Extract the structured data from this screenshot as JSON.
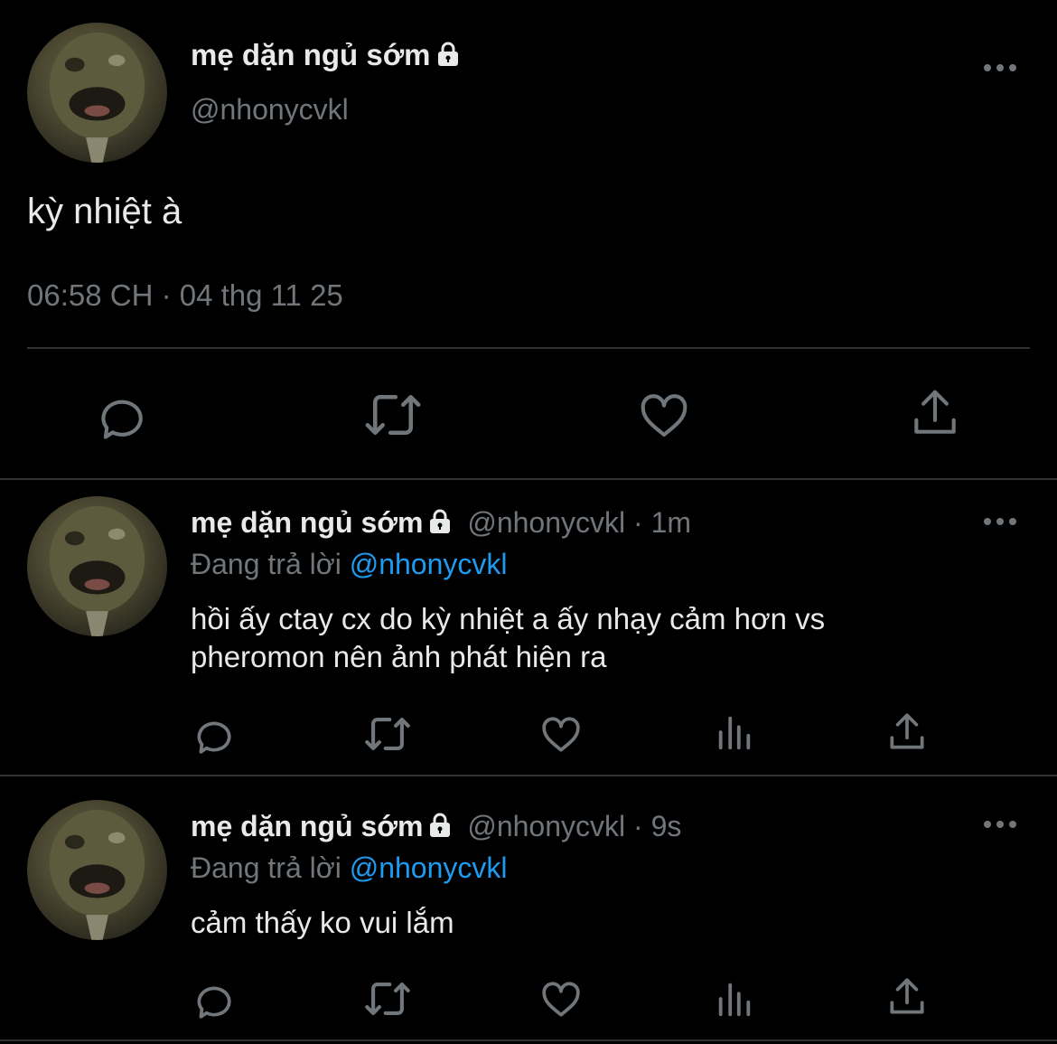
{
  "main_tweet": {
    "display_name": "mẹ dặn ngủ sớm",
    "handle": "@nhonycvkl",
    "text": "kỳ nhiệt à",
    "timestamp": "06:58 CH · 04 thg 11 25",
    "locked": true
  },
  "replies": [
    {
      "display_name": "mẹ dặn ngủ sớm",
      "handle": "@nhonycvkl",
      "time": "· 1m",
      "replying_prefix": "Đang trả lời",
      "replying_to": "@nhonycvkl",
      "text_line1": "hồi ấy ctay cx do kỳ nhiệt a ấy nhạy cảm hơn vs",
      "text_line2": "pheromon nên ảnh phát hiện ra"
    },
    {
      "display_name": "mẹ dặn ngủ sớm",
      "handle": "@nhonycvkl",
      "time": "· 9s",
      "replying_prefix": "Đang trả lời",
      "replying_to": "@nhonycvkl",
      "text_line1": "cảm thấy ko vui lắm",
      "text_line2": ""
    }
  ],
  "colors": {
    "background": "#000000",
    "text": "#e7e9ea",
    "muted": "#71767b",
    "accent": "#1d9bf0",
    "divider": "#2f3336"
  },
  "icons": [
    "more-icon",
    "lock-icon",
    "reply-icon",
    "retweet-icon",
    "like-icon",
    "views-icon",
    "share-icon"
  ]
}
